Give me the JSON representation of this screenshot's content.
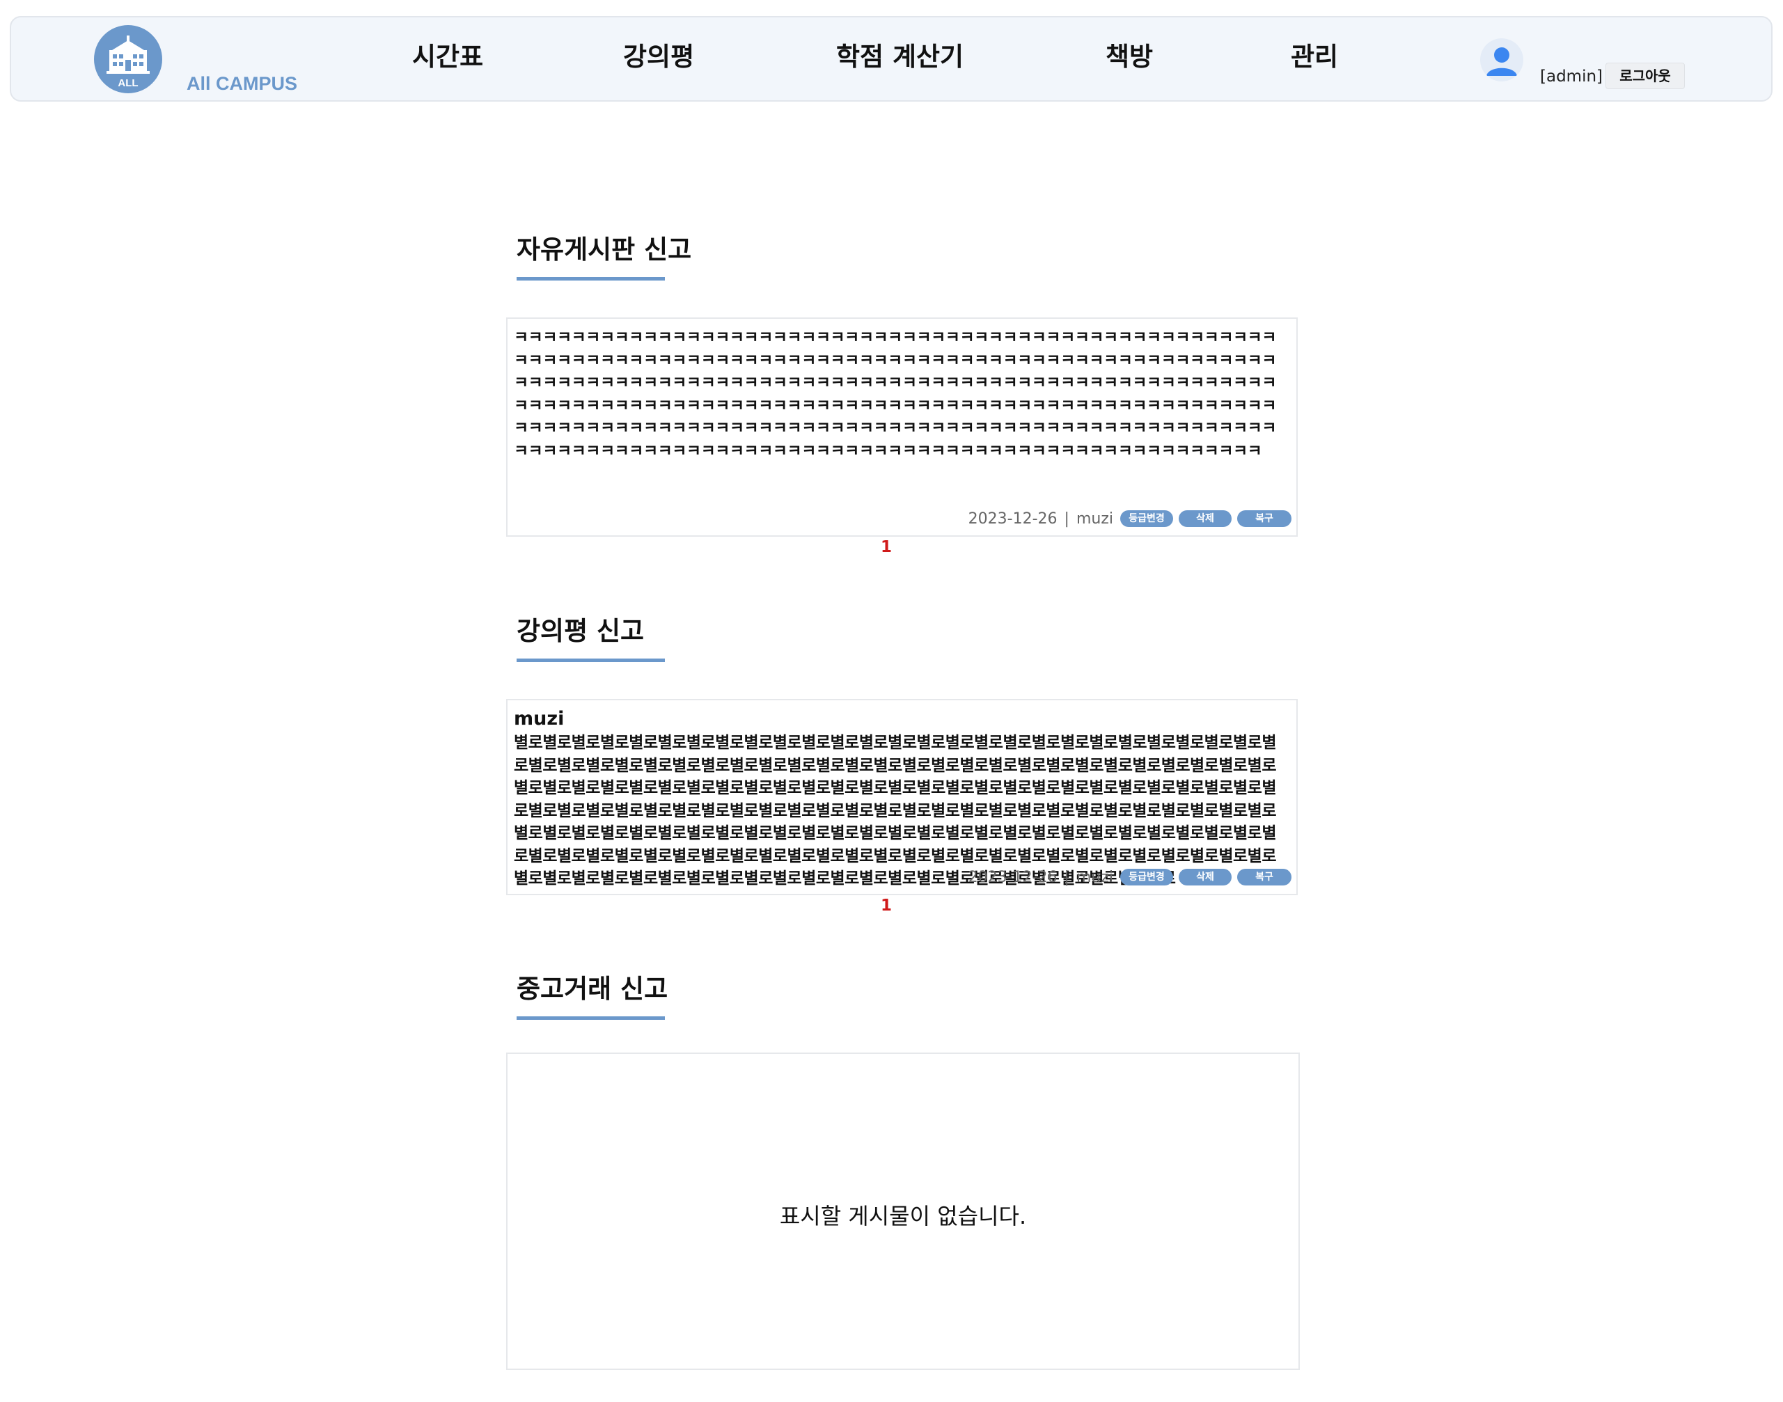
{
  "header": {
    "logo_badge": "ALL",
    "logo_text": "All CAMPUS",
    "logo_icon": "school-building-icon",
    "nav": [
      {
        "label": "시간표"
      },
      {
        "label": "강의평"
      },
      {
        "label": "학점 계산기"
      },
      {
        "label": "책방"
      },
      {
        "label": "관리"
      }
    ],
    "avatar_icon": "user-avatar-icon",
    "user_label": "[admin]",
    "logout_label": "로그아웃"
  },
  "sections": [
    {
      "title": "자유게시판 신고",
      "post": {
        "body": "ㅋㅋㅋㅋㅋㅋㅋㅋㅋㅋㅋㅋㅋㅋㅋㅋㅋㅋㅋㅋㅋㅋㅋㅋㅋㅋㅋㅋㅋㅋㅋㅋㅋㅋㅋㅋㅋㅋㅋㅋㅋㅋㅋㅋㅋㅋㅋㅋㅋㅋㅋㅋㅋㅋㅋㅋㅋㅋㅋㅋㅋㅋㅋㅋㅋㅋㅋㅋㅋㅋㅋㅋㅋㅋㅋㅋㅋㅋㅋㅋㅋㅋㅋㅋㅋㅋㅋㅋㅋㅋㅋㅋㅋㅋㅋㅋㅋㅋㅋㅋㅋㅋㅋㅋㅋㅋㅋㅋㅋㅋㅋㅋㅋㅋㅋㅋㅋㅋㅋㅋㅋㅋㅋㅋㅋㅋㅋㅋㅋㅋㅋㅋㅋㅋㅋㅋㅋㅋㅋㅋㅋㅋㅋㅋㅋㅋㅋㅋㅋㅋㅋㅋㅋㅋㅋㅋㅋㅋㅋㅋㅋㅋㅋㅋㅋㅋㅋㅋㅋㅋㅋㅋㅋㅋㅋㅋㅋㅋㅋㅋㅋㅋㅋㅋㅋㅋㅋㅋㅋㅋㅋㅋㅋㅋㅋㅋㅋㅋㅋㅋㅋㅋㅋㅋㅋㅋㅋㅋㅋㅋㅋㅋㅋㅋㅋㅋㅋㅋㅋㅋㅋㅋㅋㅋㅋㅋㅋㅋㅋㅋㅋㅋㅋㅋㅋㅋㅋㅋㅋㅋㅋㅋㅋㅋㅋㅋㅋㅋㅋㅋㅋㅋㅋㅋㅋㅋㅋㅋㅋㅋㅋㅋㅋㅋㅋㅋㅋㅋㅋㅋㅋㅋㅋㅋㅋㅋㅋㅋㅋㅋㅋㅋㅋㅋㅋㅋㅋㅋㅋㅋㅋㅋㅋㅋㅋㅋㅋㅋㅋㅋㅋㅋㅋㅋㅋㅋㅋㅋㅋㅋㅋㅋㅋㅋㅋㅋㅋ",
        "date": "2023-12-26",
        "separator": "|",
        "author": "muzi",
        "btn_grade": "등급변경",
        "btn_delete": "삭제",
        "btn_restore": "복구"
      },
      "page": "1"
    },
    {
      "title": "강의평 신고",
      "post": {
        "title": "muzi",
        "body": "별로별로별로별로별로별로별로별로별로별로별로별로별로별로별로별로별로별로별로별로별로별로별로별로별로별로별로별로별로별로별로별로별로별로별로별로별로별로별로별로별로별로별로별로별로별로별로별로별로별로별로별로별로별로별로별로별로별로별로별로별로별로별로별로별로별로별로별로별로별로별로별로별로별로별로별로별로별로별로별로별로별로별로별로별로별로별로별로별로별로별로별로별로별로별로별로별로별로별로별로별로별로별로별로별로별로별로별로별로별로별로별로별로별로별로별로별로별로별로별로별로별로별로별로별로별로별로별로별로별로별로별로별로별로별로별로별로별로별로별로별로별로별로별로별로별로별로별로별로별로별로별로별로별로별로별로별로별로별로별로별로별로별로별로별로별로별로별로별로별로별로별로별로별로별로별로별로별로별로별로별로별로",
        "date": "2023-12-26",
        "separator": "|",
        "author": "muzi",
        "btn_grade": "등급변경",
        "btn_delete": "삭제",
        "btn_restore": "복구"
      },
      "page": "1"
    },
    {
      "title": "중고거래 신고",
      "empty_message": "표시할 게시물이 없습니다."
    }
  ],
  "colors": {
    "accent": "#6b98cb",
    "header_bg": "#f2f6fb",
    "page_number": "#d01a1a"
  }
}
